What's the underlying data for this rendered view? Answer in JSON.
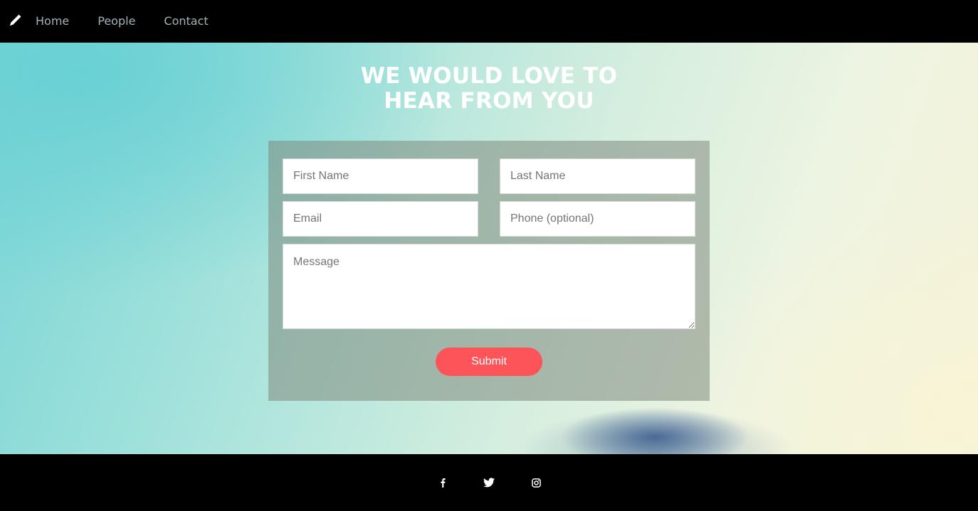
{
  "nav": {
    "brand_icon": "pencil-icon",
    "links": [
      {
        "label": "Home"
      },
      {
        "label": "People"
      },
      {
        "label": "Contact"
      }
    ]
  },
  "hero": {
    "title": "WE WOULD LOVE TO\nHEAR FROM YOU"
  },
  "form": {
    "first_name_placeholder": "First Name",
    "last_name_placeholder": "Last Name",
    "email_placeholder": "Email",
    "phone_placeholder": "Phone (optional)",
    "message_placeholder": "Message",
    "submit_label": "Submit"
  },
  "footer": {
    "social_icons": [
      "facebook-icon",
      "twitter-icon",
      "instagram-icon"
    ]
  },
  "colors": {
    "nav_bg": "#000000",
    "nav_link": "#a5b3b7",
    "submit_bg": "#fc5458",
    "footer_bg": "#000000"
  }
}
